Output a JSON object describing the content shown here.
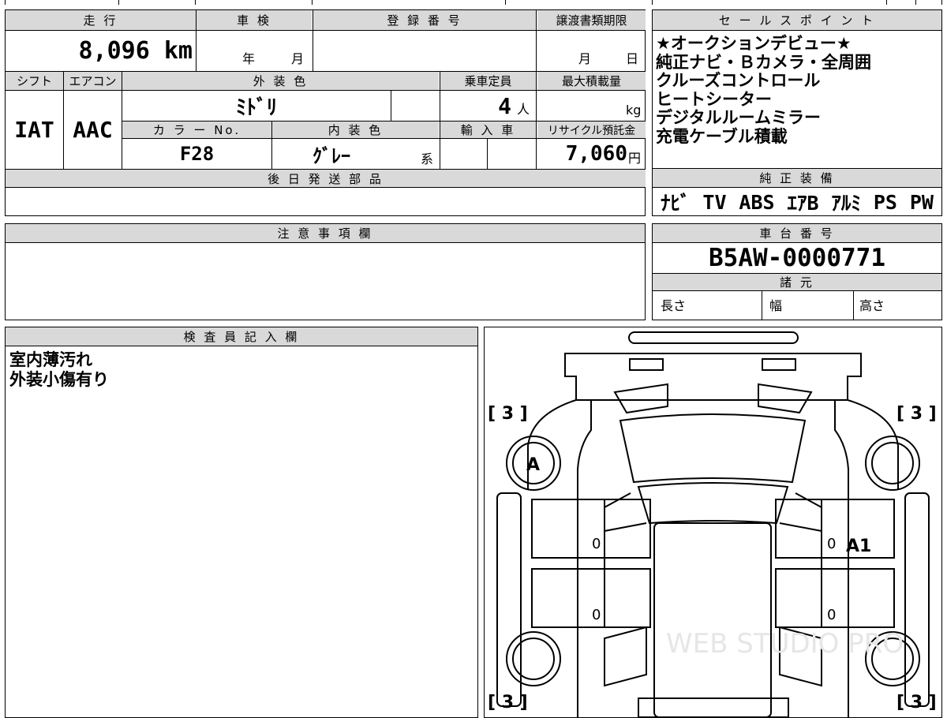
{
  "vehicle_table": {
    "mileage_label": "走 行",
    "mileage_value": "8,096 km",
    "inspection_label": "車 検",
    "inspection_year": "年",
    "inspection_month": "月",
    "registration_label": "登 録 番 号",
    "transfer_deadline_label": "譲渡書類期限",
    "transfer_month": "月",
    "transfer_day": "日",
    "shift_label": "シフト",
    "shift_value": "IAT",
    "aircon_label": "エアコン",
    "aircon_value": "AAC",
    "exterior_color_label": "外 装 色",
    "exterior_color_value": "ﾐﾄﾞﾘ",
    "capacity_label": "乗車定員",
    "capacity_value": "4",
    "capacity_unit": "人",
    "max_load_label": "最大積載量",
    "max_load_unit": "kg",
    "color_no_label": "カ ラ ー No.",
    "color_no_value": "F28",
    "interior_color_label": "内 装 色",
    "interior_color_value": "ｸﾞﾚｰ",
    "interior_color_suffix": "系",
    "import_label": "輸 入 車",
    "recycle_label": "リサイクル預託金",
    "recycle_value": "7,060",
    "recycle_unit": "円",
    "later_parts_label": "後 日 発 送 部 品"
  },
  "sales_points": {
    "label": "セ ー ル ス ポ イ ン ト",
    "lines": [
      "★オークションデビュー★",
      "純正ナビ・Ｂカメラ・全周囲",
      "クルーズコントロール",
      "ヒートシーター",
      "デジタルルームミラー",
      "充電ケーブル積載"
    ]
  },
  "genuine_equipment": {
    "label": "純 正 装 備",
    "items": [
      "ﾅﾋﾞ",
      "TV",
      "ABS",
      "ｴｱB",
      "ｱﾙﾐ",
      "PS",
      "PW"
    ]
  },
  "caution": {
    "label": "注 意 事 項 欄"
  },
  "chassis": {
    "label": "車 台 番 号",
    "value": "B5AW-0000771"
  },
  "specs": {
    "label": "諸 元",
    "length_label": "長さ",
    "width_label": "幅",
    "height_label": "高さ"
  },
  "inspector": {
    "label": "検 査 員 記 入 欄",
    "lines": [
      "室内薄汚れ",
      "外装小傷有り"
    ]
  },
  "diagram": {
    "tire_top_left": "[ 3 ]",
    "tire_top_right": "[ 3 ]",
    "tire_bottom_left": "[ 3 ]",
    "tire_bottom_right": "[ 3 ]",
    "mark_left_front": "A",
    "mark_right_door": "A1",
    "door_zero": "0",
    "watermark": "WEB STUDIO PRO"
  }
}
